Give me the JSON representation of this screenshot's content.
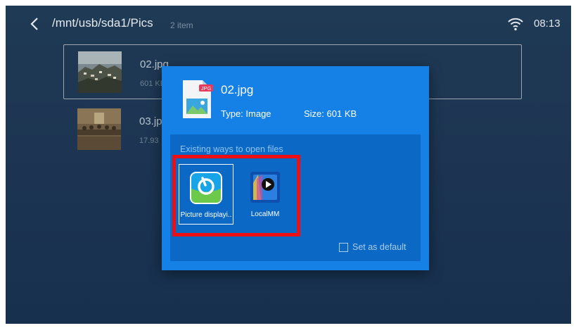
{
  "header": {
    "path": "/mnt/usb/sda1/Pics",
    "item_count": "2 item",
    "time": "08:13"
  },
  "file_list": [
    {
      "name": "02.jpg",
      "size": "601 KB"
    },
    {
      "name": "03.jpg",
      "size": "17.93"
    }
  ],
  "dialog": {
    "file_name": "02.jpg",
    "file_badge": "JPG",
    "type_text": "Type:  Image",
    "size_text": "Size:  601 KB",
    "apps_heading": "Existing ways to open files",
    "apps": [
      {
        "label": "Picture displayi..",
        "icon": "picture-player-icon"
      },
      {
        "label": "LocalMM",
        "icon": "localmm-icon"
      }
    ],
    "set_default_label": "Set as default",
    "set_default_checked": false
  },
  "colors": {
    "background": "#1d3552",
    "dialog": "#1581e6",
    "panel": "#0b68c4",
    "highlight": "#ee0f14"
  }
}
